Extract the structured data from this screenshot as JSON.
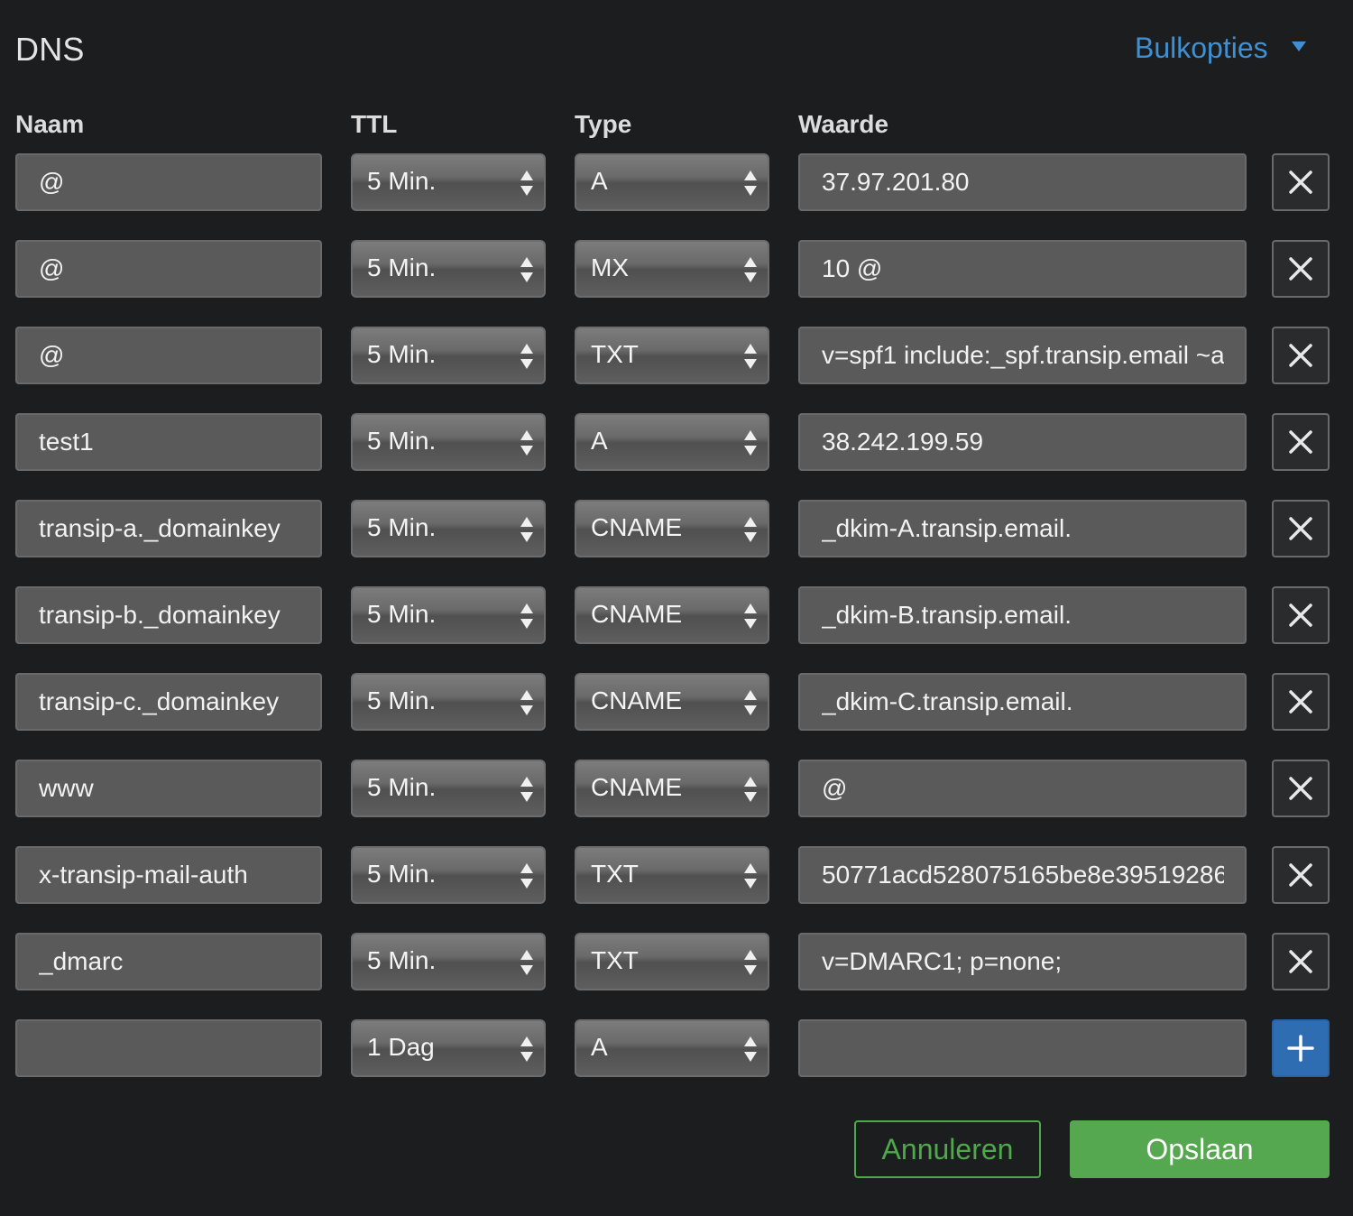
{
  "header": {
    "title": "DNS",
    "bulk_label": "Bulkopties",
    "bulk_icon": "caret-down-icon"
  },
  "columns": {
    "name": "Naam",
    "ttl": "TTL",
    "type": "Type",
    "value": "Waarde"
  },
  "records": [
    {
      "name": "@",
      "ttl": "5 Min.",
      "type": "A",
      "value": "37.97.201.80"
    },
    {
      "name": "@",
      "ttl": "5 Min.",
      "type": "MX",
      "value": "10 @"
    },
    {
      "name": "@",
      "ttl": "5 Min.",
      "type": "TXT",
      "value": "v=spf1 include:_spf.transip.email ~a"
    },
    {
      "name": "test1",
      "ttl": "5 Min.",
      "type": "A",
      "value": "38.242.199.59"
    },
    {
      "name": "transip-a._domainkey",
      "ttl": "5 Min.",
      "type": "CNAME",
      "value": "_dkim-A.transip.email."
    },
    {
      "name": "transip-b._domainkey",
      "ttl": "5 Min.",
      "type": "CNAME",
      "value": "_dkim-B.transip.email."
    },
    {
      "name": "transip-c._domainkey",
      "ttl": "5 Min.",
      "type": "CNAME",
      "value": "_dkim-C.transip.email."
    },
    {
      "name": "www",
      "ttl": "5 Min.",
      "type": "CNAME",
      "value": "@"
    },
    {
      "name": "x-transip-mail-auth",
      "ttl": "5 Min.",
      "type": "TXT",
      "value": "50771acd528075165be8e39519286"
    },
    {
      "name": "_dmarc",
      "ttl": "5 Min.",
      "type": "TXT",
      "value": "v=DMARC1; p=none;"
    }
  ],
  "new_record": {
    "name": "",
    "ttl": "1 Dag",
    "type": "A",
    "value": ""
  },
  "actions": {
    "cancel_label": "Annuleren",
    "save_label": "Opslaan"
  },
  "colors": {
    "background": "#1c1d1f",
    "accent_blue": "#3f8fd3",
    "add_button": "#2f6db3",
    "save_green": "#55a850"
  }
}
